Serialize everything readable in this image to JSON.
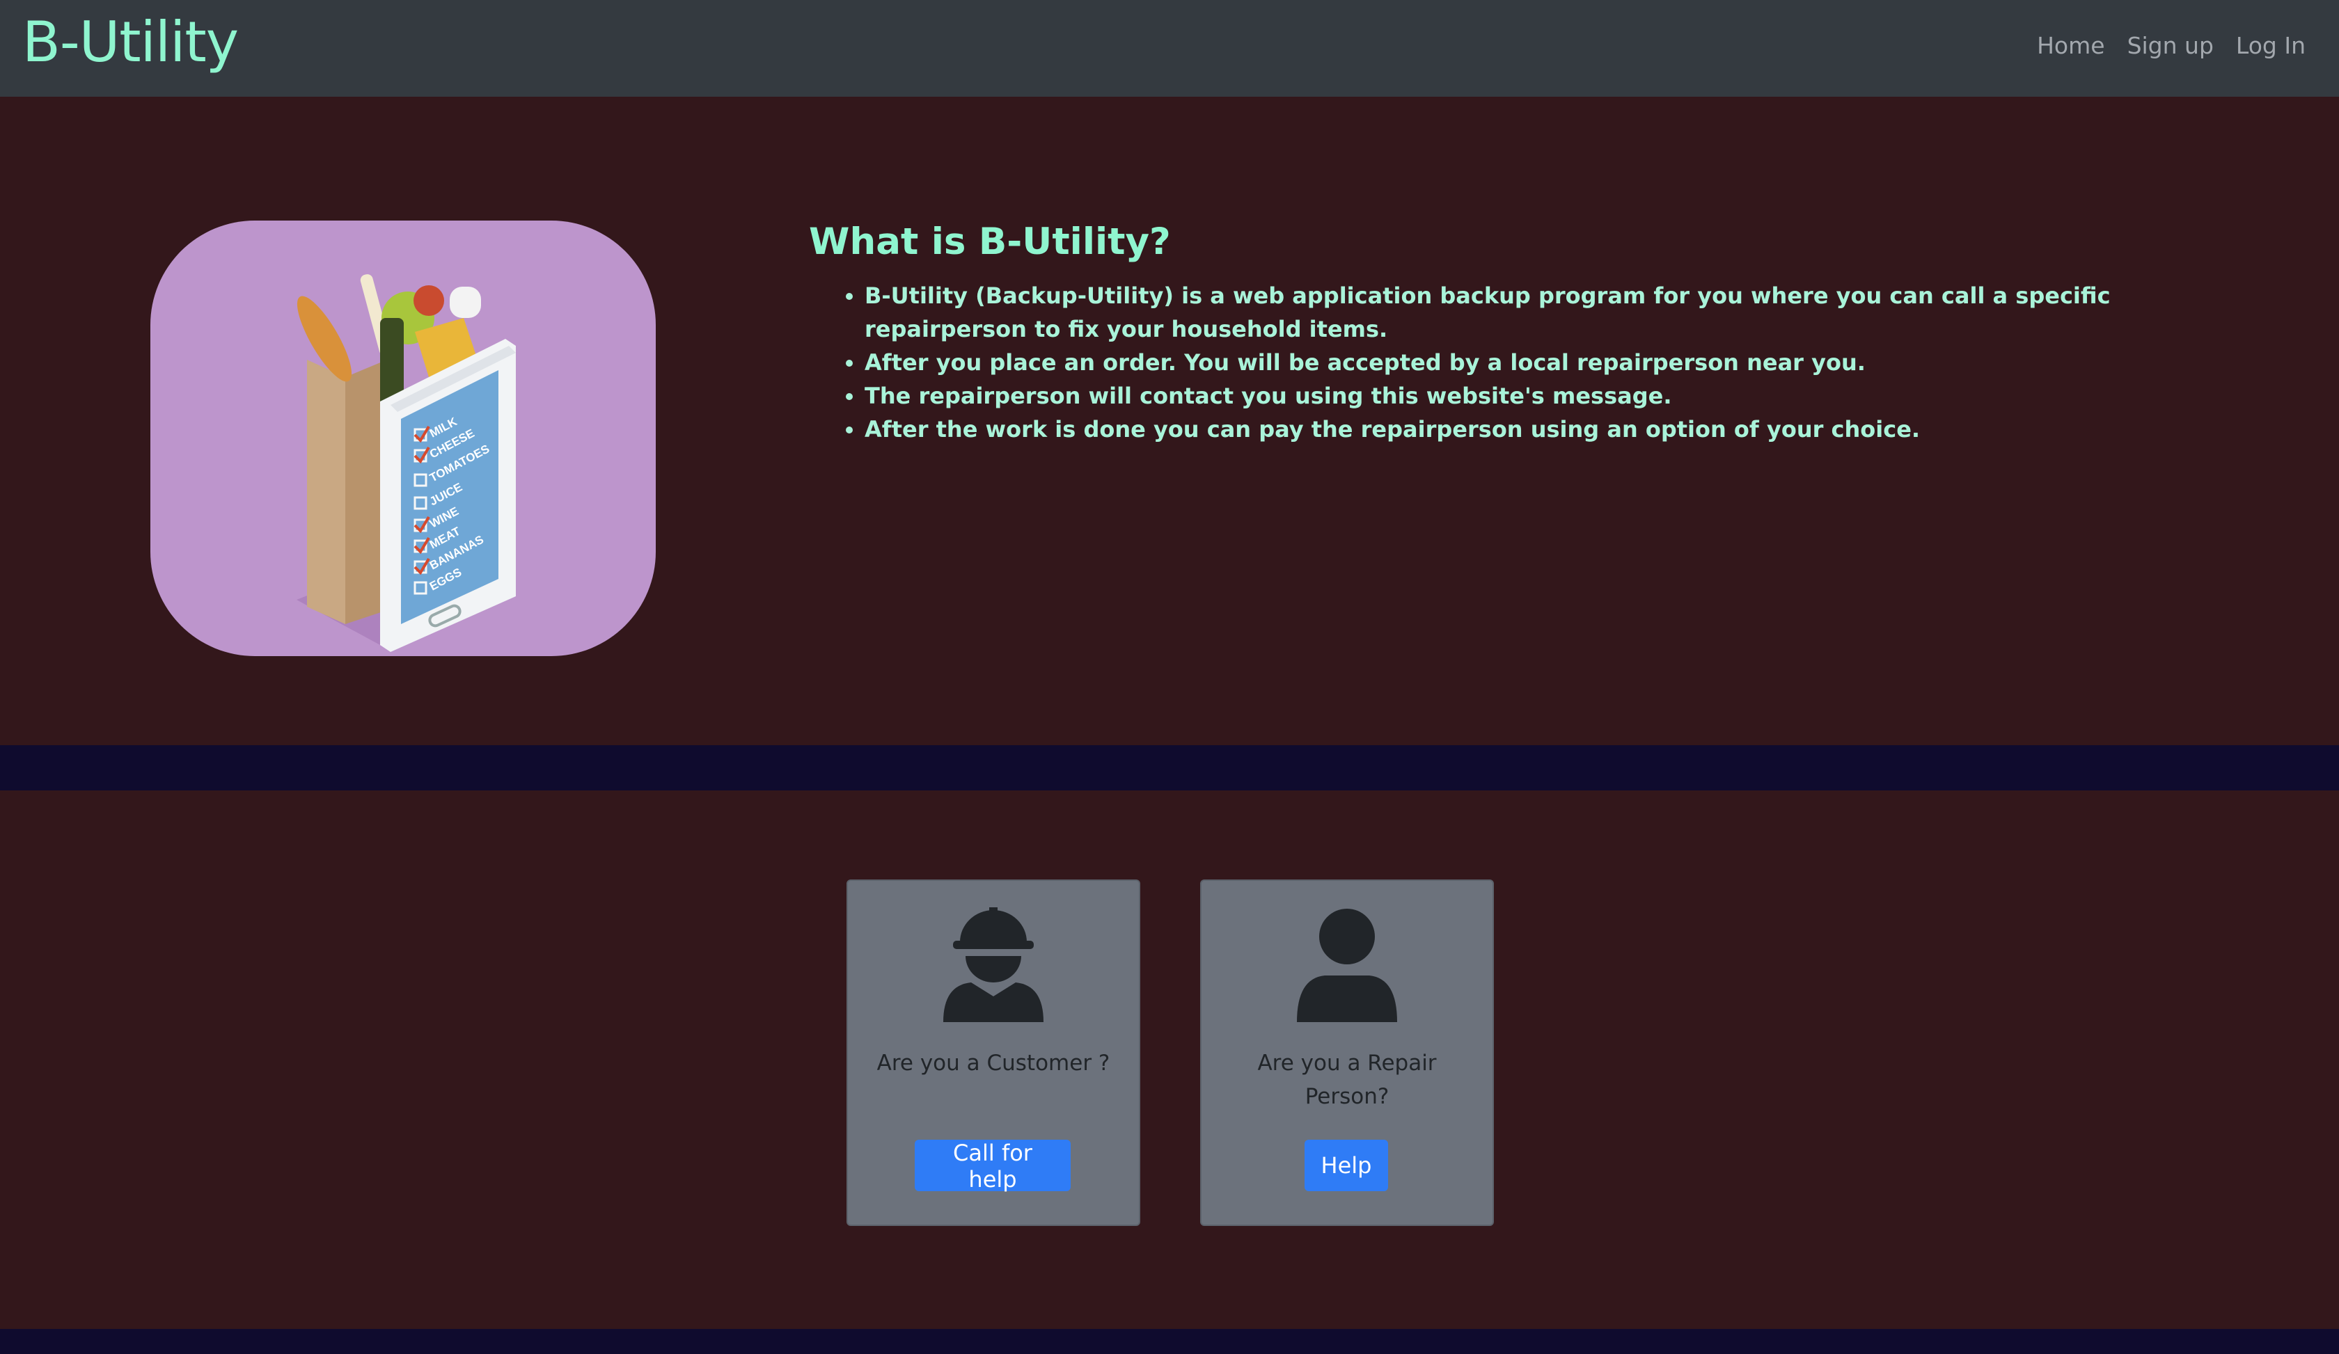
{
  "navbar": {
    "brand": "B-Utility",
    "links": [
      "Home",
      "Sign up",
      "Log In"
    ]
  },
  "hero": {
    "image_alt_icon": "grocery-bag-phone-checklist-illustration",
    "checklist_items": [
      "MILK",
      "CHEESE",
      "TOMATOES",
      "JUICE",
      "WINE",
      "MEAT",
      "BANANAS",
      "EGGS"
    ],
    "title": "What is B-Utility?",
    "bullets": [
      "B-Utility (Backup-Utility) is a web application backup program for you where you can call a specific repairperson to fix your household items.",
      "After you place an order. You will be accepted by a local repairperson near you.",
      "The repairperson will contact you using this website's message.",
      "After the work is done you can pay the repairperson using an option of your choice."
    ]
  },
  "roles": {
    "customer": {
      "icon": "hard-hat-worker-icon",
      "text": "Are you a Customer ?",
      "button": "Call for help"
    },
    "repair": {
      "icon": "user-icon",
      "text": "Are you a Repair Person?",
      "button": "Help"
    }
  },
  "colors": {
    "navbar": "#343a40",
    "brand": "#8ff5cf",
    "section_bg": "#33171b",
    "page_bg": "#0f0b2e",
    "card_bg": "#6c727c",
    "button": "#2f7cf6"
  }
}
